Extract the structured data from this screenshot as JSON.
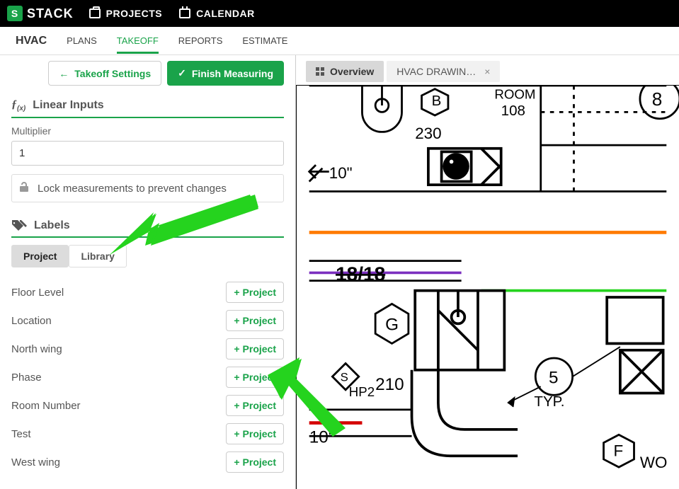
{
  "header": {
    "brand": "STACK",
    "nav": [
      {
        "label": "PROJECTS"
      },
      {
        "label": "CALENDAR"
      }
    ]
  },
  "subnav": {
    "project": "HVAC",
    "tabs": [
      "PLANS",
      "TAKEOFF",
      "REPORTS",
      "ESTIMATE"
    ],
    "active": "TAKEOFF"
  },
  "sidebar": {
    "buttons": {
      "takeoff_settings": "Takeoff Settings",
      "finish_measuring": "Finish Measuring"
    },
    "linear_inputs": {
      "heading": "Linear Inputs",
      "multiplier_label": "Multiplier",
      "multiplier_value": "1",
      "lock_text": "Lock measurements to prevent changes"
    },
    "labels_section": {
      "heading": "Labels",
      "tabs": {
        "project": "Project",
        "library": "Library"
      },
      "active_tab": "Project",
      "add_button_label": "Project",
      "items": [
        {
          "name": "Floor Level"
        },
        {
          "name": "Location"
        },
        {
          "name": "North wing"
        },
        {
          "name": "Phase"
        },
        {
          "name": "Room Number"
        },
        {
          "name": "Test"
        },
        {
          "name": "West wing"
        }
      ]
    }
  },
  "canvas": {
    "tabs": [
      {
        "label": "Overview",
        "active": true,
        "closable": false
      },
      {
        "label": "HVAC DRAWIN…",
        "active": false,
        "closable": true
      }
    ],
    "drawing_annotations": {
      "texts": [
        "ROOM",
        "108",
        "230",
        "10\"",
        "B",
        "G",
        "210",
        "HP2",
        "S",
        "5",
        "TYP.",
        "F",
        "WO",
        "8",
        "10\"",
        "18/18"
      ]
    }
  },
  "colors": {
    "accent_green": "#1aa34a",
    "arrow_green": "#25d31e",
    "orange": "#ff7a00",
    "purple": "#7b2fbf"
  }
}
